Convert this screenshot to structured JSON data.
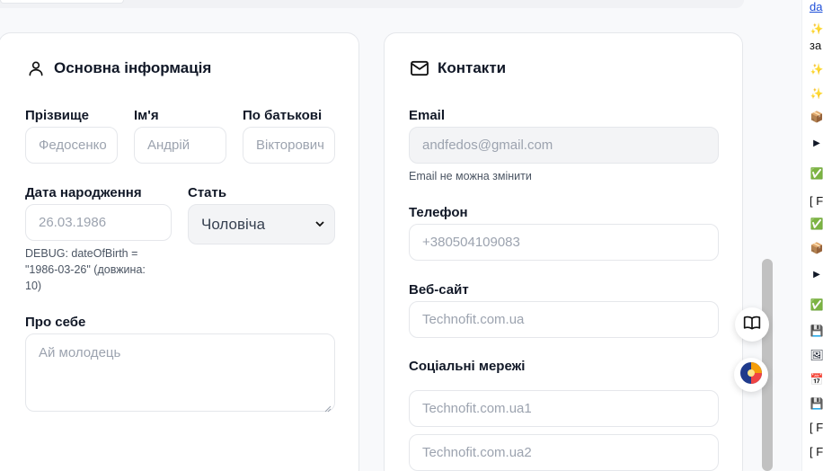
{
  "basic": {
    "title": "Основна інформація",
    "surname_label": "Прізвище",
    "surname_placeholder": "Федосенко",
    "name_label": "Ім'я",
    "name_placeholder": "Андрій",
    "patronymic_label": "По батькові",
    "patronymic_placeholder": "Вікторович",
    "dob_label": "Дата народження",
    "dob_value": "26.03.1986",
    "gender_label": "Стать",
    "gender_value": "Чоловіча",
    "debug_line1": "DEBUG: dateOfBirth =",
    "debug_line2": "\"1986-03-26\" (довжина:",
    "debug_line3": "10)",
    "about_label": "Про себе",
    "about_placeholder": "Ай молодець"
  },
  "contacts": {
    "title": "Контакти",
    "email_label": "Email",
    "email_value": "andfedos@gmail.com",
    "email_hint": "Email не можна змінити",
    "phone_label": "Телефон",
    "phone_placeholder": "+380504109083",
    "website_label": "Веб-сайт",
    "website_placeholder": "Technofit.com.ua",
    "social_label": "Соціальні мережі",
    "social1_placeholder": "Technofit.com.ua1",
    "social2_placeholder": "Technofit.com.ua2"
  },
  "sidebar": {
    "link_text": "da",
    "text_za": "за",
    "bracket_items": [
      "[ F",
      "[ F",
      "[ F"
    ]
  },
  "icons": {
    "user": "user-icon",
    "mail": "mail-icon",
    "book": "book-icon",
    "palette": "palette-icon",
    "chevron": "chevron-down-icon"
  }
}
